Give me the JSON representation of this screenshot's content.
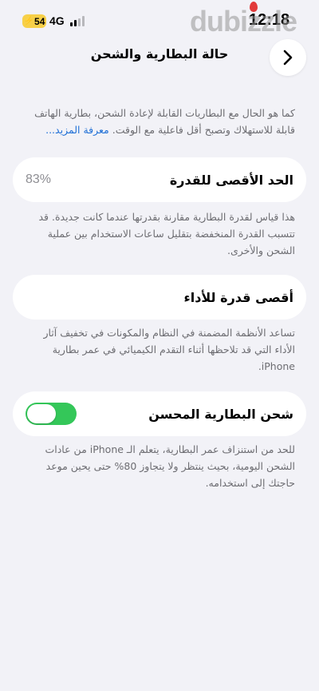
{
  "status_bar": {
    "battery_level": "54",
    "network": "4G",
    "time": "12:18"
  },
  "watermark": "dubizzle",
  "nav": {
    "title": "حالة البطارية والشحن",
    "back_icon": "chevron-right-icon"
  },
  "intro": {
    "text": "كما هو الحال مع البطاريات القابلة لإعادة الشحن، بطارية الهاتف قابلة للاستهلاك وتصبح أقل فاعلية مع الوقت.",
    "link": "معرفة المزيد..."
  },
  "max_capacity": {
    "label": "الحد الأقصى للقدرة",
    "value": "83%",
    "description": "هذا قياس لقدرة البطارية مقارنة بقدرتها عندما كانت جديدة. قد تتسبب القدرة المنخفضة بتقليل ساعات الاستخدام بين عملية الشحن والأخرى."
  },
  "peak_performance": {
    "label": "أقصى قدرة للأداء",
    "description": "تساعد الأنظمة المضمنة في النظام والمكونات في تخفيف آثار الأداء التي قد تلاحظها أثناء التقدم الكيميائي في عمر بطارية iPhone."
  },
  "optimized_charging": {
    "label": "شحن البطارية المحسن",
    "enabled": true,
    "description": "للحد من استنزاف عمر البطارية، يتعلم الـ iPhone من عادات الشحن اليومية، بحيث ينتظر ولا يتجاوز 80% حتى يحين موعد حاجتك إلى استخدامه."
  },
  "colors": {
    "background": "#f2f2f7",
    "toggle_on": "#34c759",
    "link": "#1f6fd6",
    "battery_pill": "#f7d048"
  }
}
